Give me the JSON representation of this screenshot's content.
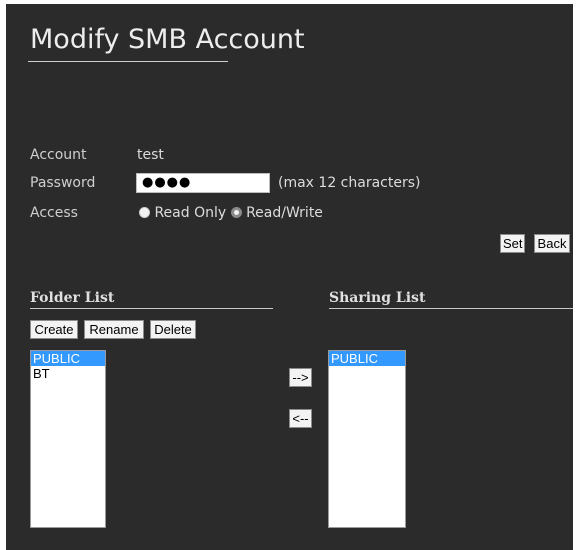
{
  "page": {
    "title": "Modify SMB Account"
  },
  "form": {
    "account_label": "Account",
    "account_value": "test",
    "password_label": "Password",
    "password_value": "●●●●",
    "password_hint": "(max 12 characters)",
    "access_label": "Access",
    "access_options": [
      {
        "label": "Read Only",
        "selected": false
      },
      {
        "label": "Read/Write",
        "selected": true
      }
    ]
  },
  "actions": {
    "set_label": "Set",
    "back_label": "Back"
  },
  "folder_list": {
    "title": "Folder List",
    "create_label": "Create",
    "rename_label": "Rename",
    "delete_label": "Delete",
    "items": [
      {
        "label": "PUBLIC",
        "selected": true
      },
      {
        "label": "BT",
        "selected": false
      }
    ]
  },
  "transfer": {
    "add_label": "-->",
    "remove_label": "<--"
  },
  "sharing_list": {
    "title": "Sharing List",
    "items": [
      {
        "label": "PUBLIC",
        "selected": true
      }
    ]
  },
  "colors": {
    "panel_bg": "#2b2b2b",
    "selection": "#3399ff"
  }
}
